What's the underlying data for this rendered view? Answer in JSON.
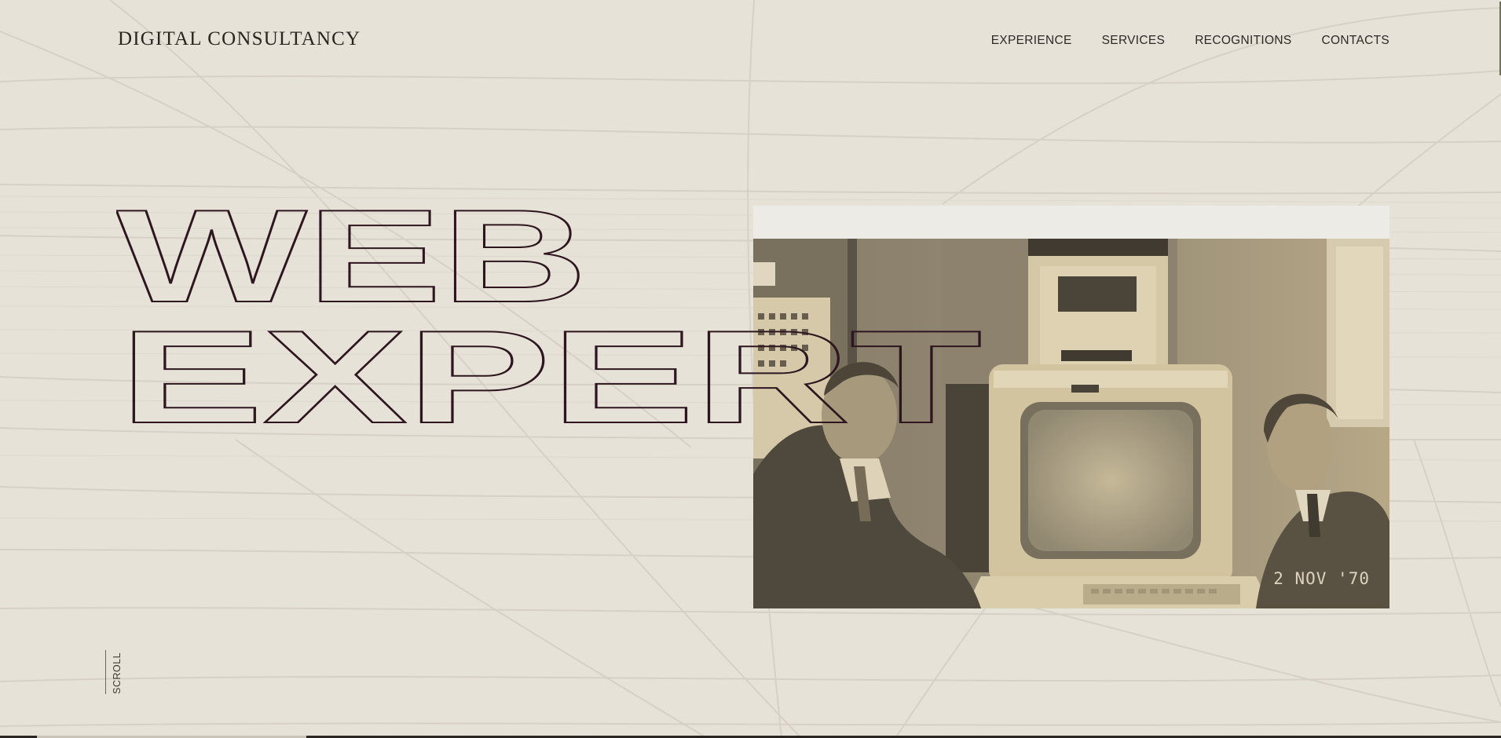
{
  "brand": {
    "name": "DIGITAL CONSULTANCY"
  },
  "nav": {
    "items": [
      {
        "label": "EXPERIENCE"
      },
      {
        "label": "SERVICES"
      },
      {
        "label": "RECOGNITIONS"
      },
      {
        "label": "CONTACTS"
      }
    ]
  },
  "hero": {
    "line1": "WEB",
    "line2": "EXPERT",
    "photo_date": "2 NOV '70"
  },
  "scroll": {
    "label": "SCROLL"
  },
  "colors": {
    "background": "#e7e2d8",
    "headline_outline": "#2e1620",
    "text": "#2a2320",
    "photo_frame": "#ecebe6",
    "accent": "#6e7556"
  },
  "icons": {
    "scroll": "scroll-line-icon"
  }
}
